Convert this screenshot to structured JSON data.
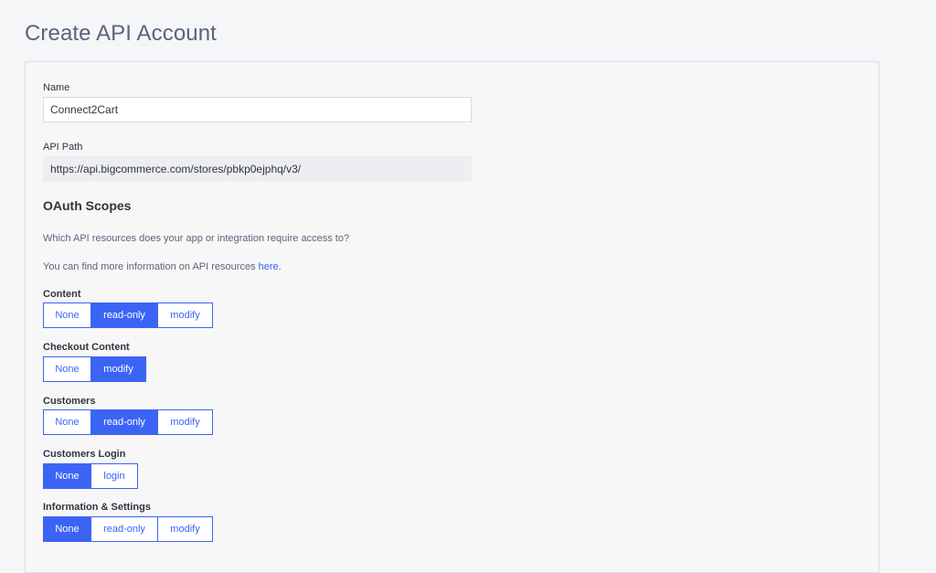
{
  "page": {
    "title": "Create API Account"
  },
  "form": {
    "name": {
      "label": "Name",
      "value": "Connect2Cart"
    },
    "api_path": {
      "label": "API Path",
      "value": "https://api.bigcommerce.com/stores/pbkp0ejphq/v3/"
    },
    "oauth": {
      "heading": "OAuth Scopes",
      "question": "Which API resources does your app or integration require access to?",
      "info_prefix": "You can find more information on API resources ",
      "info_link": "here",
      "info_suffix": "."
    },
    "scopes": [
      {
        "label": "Content",
        "options": [
          {
            "label": "None",
            "selected": false
          },
          {
            "label": "read-only",
            "selected": true
          },
          {
            "label": "modify",
            "selected": false
          }
        ]
      },
      {
        "label": "Checkout Content",
        "options": [
          {
            "label": "None",
            "selected": false
          },
          {
            "label": "modify",
            "selected": true
          }
        ]
      },
      {
        "label": "Customers",
        "options": [
          {
            "label": "None",
            "selected": false
          },
          {
            "label": "read-only",
            "selected": true
          },
          {
            "label": "modify",
            "selected": false
          }
        ]
      },
      {
        "label": "Customers Login",
        "options": [
          {
            "label": "None",
            "selected": true
          },
          {
            "label": "login",
            "selected": false
          }
        ]
      },
      {
        "label": "Information & Settings",
        "options": [
          {
            "label": "None",
            "selected": true
          },
          {
            "label": "read-only",
            "selected": false
          },
          {
            "label": "modify",
            "selected": false
          }
        ]
      }
    ]
  },
  "colors": {
    "accent": "#3c64f4",
    "title": "#5e637a",
    "text": "#313440",
    "border": "#d9dce9"
  }
}
